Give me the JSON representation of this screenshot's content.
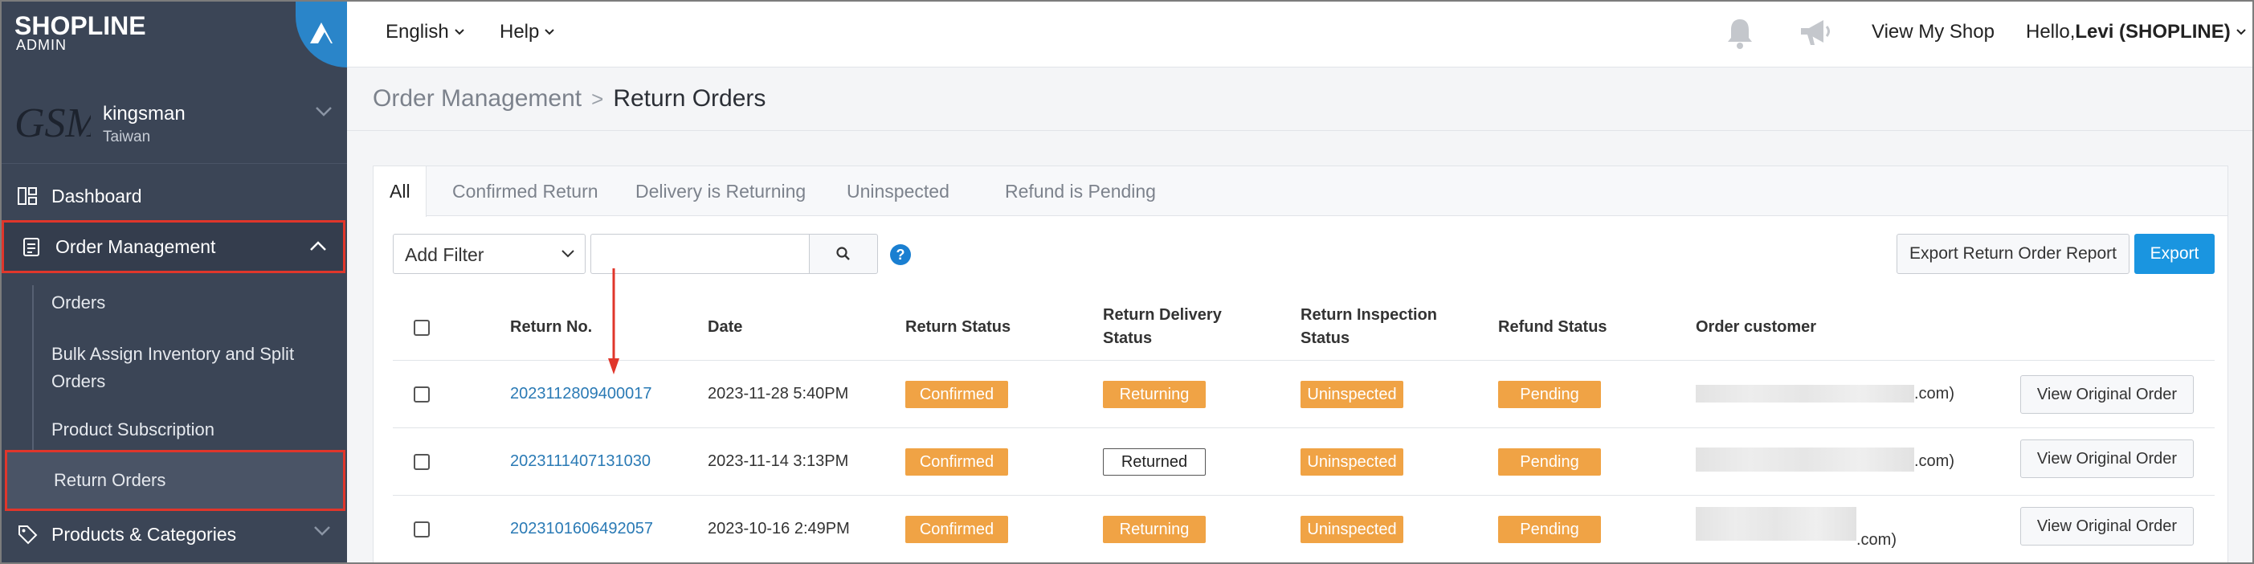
{
  "brand": {
    "logo_text": "SHOPLINE",
    "logo_sub": "ADMIN"
  },
  "store": {
    "avatar_text": "GSM",
    "name": "kingsman",
    "country": "Taiwan"
  },
  "sidebar": {
    "items": [
      {
        "label": "Dashboard",
        "icon": "dashboard-icon"
      },
      {
        "label": "Order Management",
        "icon": "clipboard-icon"
      },
      {
        "label": "Products & Categories",
        "icon": "tag-icon"
      }
    ],
    "order_subitems": [
      {
        "label": "Orders"
      },
      {
        "label": "Bulk Assign Inventory and Split Orders"
      },
      {
        "label": "Product Subscription"
      },
      {
        "label": "Return Orders"
      }
    ]
  },
  "topbar": {
    "language": "English",
    "help": "Help",
    "view_shop": "View My Shop",
    "greeting_prefix": "Hello, ",
    "greeting_user": "Levi (SHOPLINE)"
  },
  "breadcrumb": {
    "parent": "Order Management",
    "separator": ">",
    "current": "Return Orders"
  },
  "tabs": [
    "All",
    "Confirmed Return",
    "Delivery is Returning",
    "Uninspected",
    "Refund is Pending"
  ],
  "filters": {
    "add_filter": "Add Filter",
    "search_placeholder": ""
  },
  "actions": {
    "export_report": "Export Return Order Report",
    "export": "Export"
  },
  "table": {
    "headers": {
      "return_no": "Return No.",
      "date": "Date",
      "return_status": "Return Status",
      "delivery_status_1": "Return Delivery",
      "delivery_status_2": "Status",
      "inspection_status_1": "Return Inspection",
      "inspection_status_2": "Status",
      "refund_status": "Refund Status",
      "order_customer": "Order customer"
    },
    "rows": [
      {
        "return_no": "2023112809400017",
        "date": "2023-11-28 5:40PM",
        "return_status": "Confirmed",
        "delivery_status": "Returning",
        "inspection_status": "Uninspected",
        "refund_status": "Pending",
        "customer_suffix": ".com)",
        "action": "View Original Order"
      },
      {
        "return_no": "2023111407131030",
        "date": "2023-11-14 3:13PM",
        "return_status": "Confirmed",
        "delivery_status": "Returned",
        "inspection_status": "Uninspected",
        "refund_status": "Pending",
        "customer_suffix": ".com)",
        "action": "View Original Order"
      },
      {
        "return_no": "2023101606492057",
        "date": "2023-10-16 2:49PM",
        "return_status": "Confirmed",
        "delivery_status": "Returning",
        "inspection_status": "Uninspected",
        "refund_status": "Pending",
        "customer_suffix": ".com)",
        "action": "View Original Order"
      }
    ]
  },
  "colors": {
    "sidebar_bg": "#3b4556",
    "highlight": "#e0362b",
    "accent": "#1a95e0",
    "badge_orange": "#f0a345",
    "link": "#2a7ab5"
  }
}
